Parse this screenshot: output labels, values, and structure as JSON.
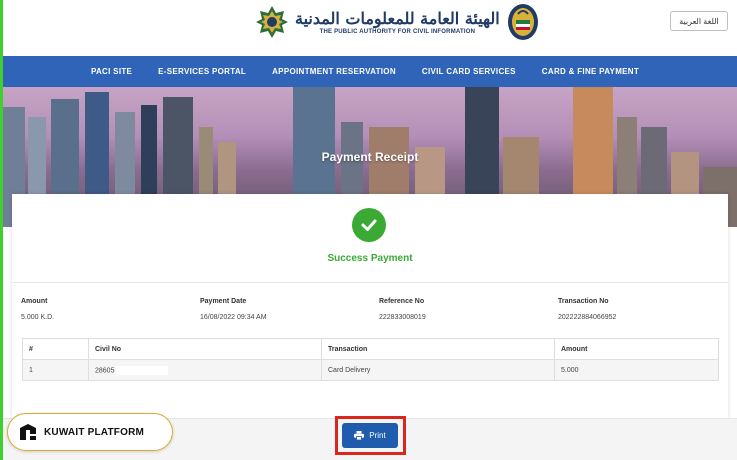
{
  "header": {
    "logo_arabic": "الهيئة العامة للمعلومات المدنية",
    "logo_english": "THE PUBLIC AUTHORITY FOR CIVIL INFORMATION",
    "language_button": "اللغة العربية"
  },
  "nav": {
    "items": [
      "PACI SITE",
      "E-SERVICES PORTAL",
      "APPOINTMENT RESERVATION",
      "CIVIL CARD SERVICES",
      "CARD & FINE PAYMENT"
    ]
  },
  "banner": {
    "title": "Payment Receipt"
  },
  "receipt": {
    "status": "Success Payment",
    "amount_label": "Amount",
    "amount_value": "5.000 K.D.",
    "date_label": "Payment Date",
    "date_value": "16/08/2022 09:34 AM",
    "reference_label": "Reference No",
    "reference_value": "222833008019",
    "transaction_label": "Transaction No",
    "transaction_value": "202222884066952",
    "table": {
      "headers": [
        "#",
        "Civil No",
        "Transaction",
        "Amount"
      ],
      "rows": [
        [
          "1",
          "28605",
          "Card Delivery",
          "5.000"
        ]
      ]
    }
  },
  "print_button": "Print",
  "badge": {
    "text": "KUWAIT PLATFORM"
  },
  "colors": {
    "nav": "#2f64b8",
    "success": "#3aaa35",
    "print": "#1f5cae",
    "highlight": "#d9271e"
  }
}
